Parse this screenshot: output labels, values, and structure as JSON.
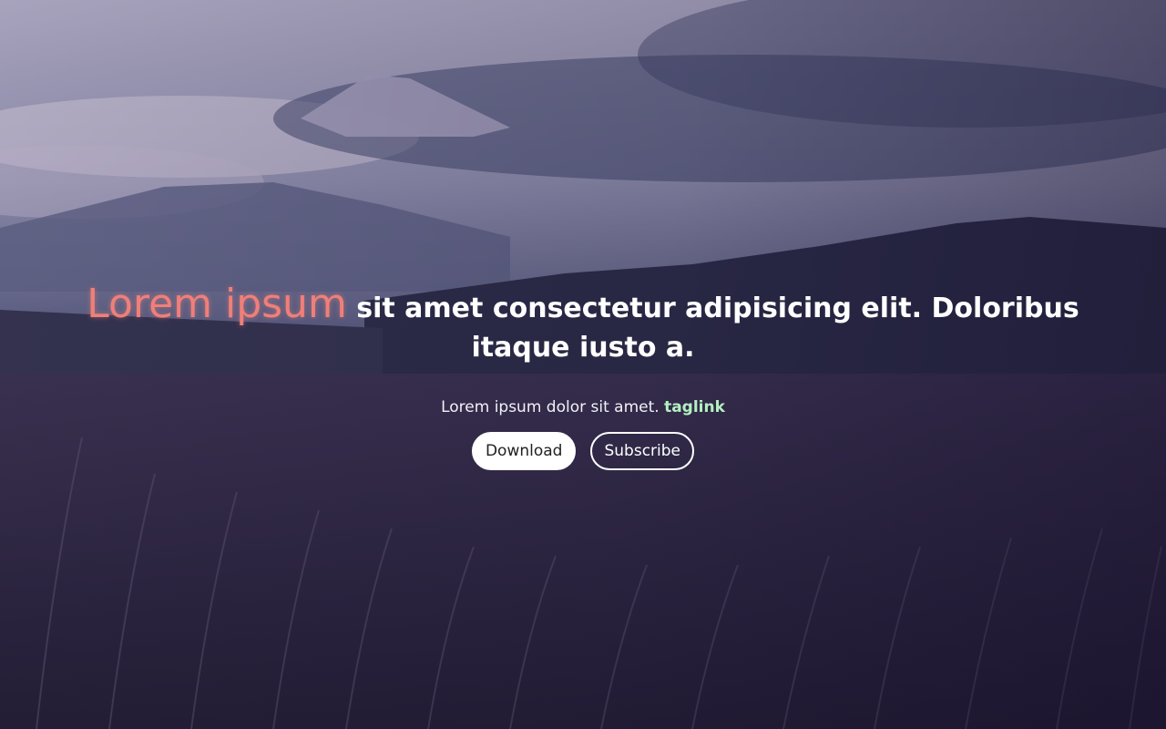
{
  "hero": {
    "headline_accent": "Lorem ipsum",
    "headline_rest": " sit amet consectetur adipisicing elit. Doloribus itaque iusto a.",
    "subtitle": "Lorem ipsum dolor sit amet.",
    "taglink": "taglink",
    "download_label": "Download",
    "subscribe_label": "Subscribe"
  },
  "colors": {
    "accent": "#f07f78",
    "taglink": "#b4f0c2",
    "button_fill": "#ffffff"
  }
}
